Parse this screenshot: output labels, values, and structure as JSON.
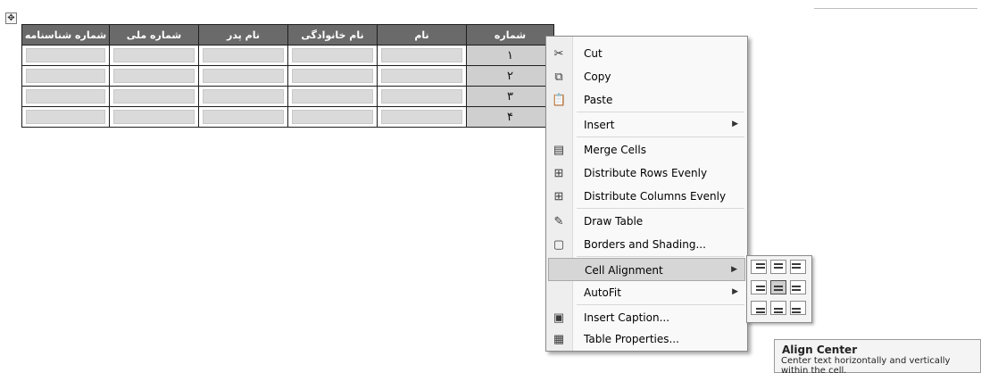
{
  "table": {
    "headers": [
      "شماره",
      "نام",
      "نام خانوادگی",
      "نام پدر",
      "شماره ملی",
      "شماره شناسنامه"
    ],
    "row_numbers": [
      "۱",
      "۲",
      "۳",
      "۴"
    ]
  },
  "menu": {
    "items": [
      {
        "label": "Cut",
        "icon": "scissors-icon"
      },
      {
        "label": "Copy",
        "icon": "copy-icon"
      },
      {
        "label": "Paste",
        "icon": "paste-icon"
      },
      {
        "label": "Insert",
        "icon": "",
        "submenu": true
      },
      {
        "label": "Merge Cells",
        "icon": "merge-cells-icon"
      },
      {
        "label": "Distribute Rows Evenly",
        "icon": "distribute-rows-icon"
      },
      {
        "label": "Distribute Columns Evenly",
        "icon": "distribute-columns-icon"
      },
      {
        "label": "Draw Table",
        "icon": "draw-table-icon"
      },
      {
        "label": "Borders and Shading...",
        "icon": "borders-icon"
      },
      {
        "label": "Cell Alignment",
        "icon": "",
        "submenu": true,
        "highlighted": true
      },
      {
        "label": "AutoFit",
        "icon": "",
        "submenu": true
      },
      {
        "label": "Insert Caption...",
        "icon": "caption-icon"
      },
      {
        "label": "Table Properties...",
        "icon": "table-properties-icon"
      }
    ]
  },
  "alignment": {
    "selected": "Align Center"
  },
  "tooltip": {
    "title": "Align Center",
    "description": "Center text horizontally and vertically within the cell."
  }
}
